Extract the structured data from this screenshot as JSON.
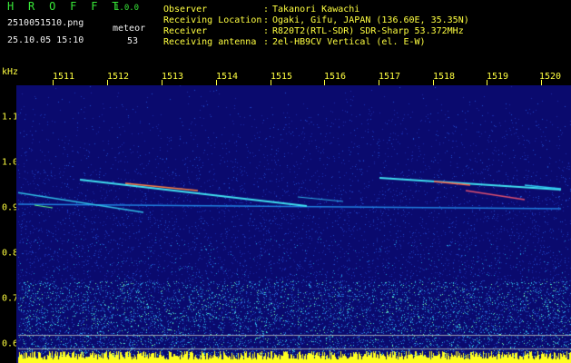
{
  "header": {
    "app_title": "H R O F F T",
    "app_version": "1.0.0",
    "file_name": "2510051510.png",
    "datetime": "25.10.05 15:10",
    "mode_label": "meteor",
    "count_value": "53"
  },
  "info": [
    {
      "label": "Observer",
      "value": "Takanori Kawachi"
    },
    {
      "label": "Receiving Location",
      "value": "Ogaki, Gifu, JAPAN (136.60E, 35.35N)"
    },
    {
      "label": "Receiver",
      "value": "R820T2(RTL-SDR) SDR-Sharp 53.372MHz"
    },
    {
      "label": "Receiving antenna",
      "value": "2el-HB9CV Vertical (el. E-W)"
    }
  ],
  "ruler": {
    "minute_labels": [
      "1511",
      "1512",
      "1513",
      "1514",
      "1515",
      "1516",
      "1517",
      "1518",
      "1519",
      "1520"
    ]
  },
  "freq_axis": {
    "unit": "kHz",
    "labels": [
      "1.1",
      "1.0",
      "0.9",
      "0.8",
      "0.7",
      "0.6"
    ],
    "values": [
      1.1,
      1.0,
      0.9,
      0.8,
      0.7,
      0.6
    ]
  },
  "colors": {
    "background": "#000000",
    "title_green": "#38e838",
    "label_yellow": "#ffff40",
    "spectrum_base": "#10108a",
    "signal_cyan": "#40f0ff"
  }
}
